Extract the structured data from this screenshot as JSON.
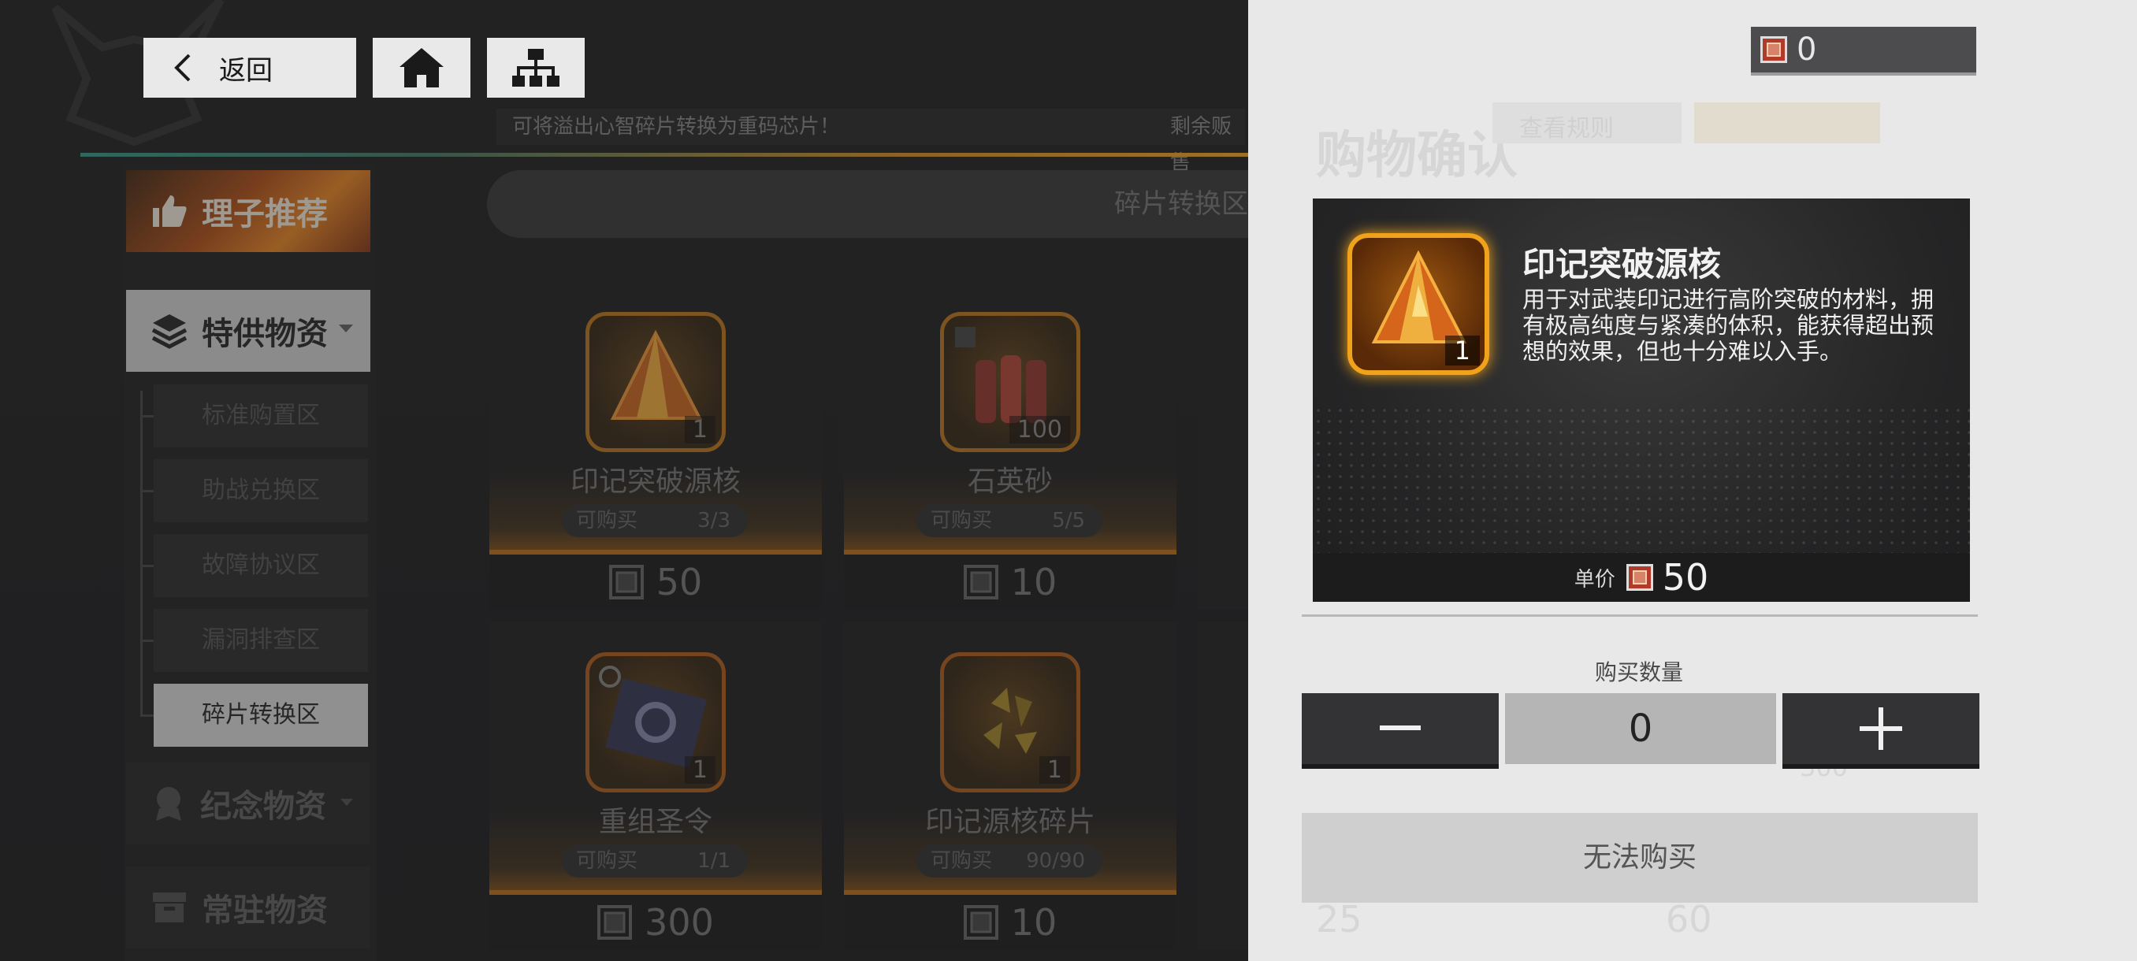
{
  "topbar": {
    "back_label": "返回",
    "notice": "可将溢出心智碎片转换为重码芯片！",
    "notice_right": "剩余贩售"
  },
  "sidebar": {
    "recommend": "理子推荐",
    "special": "特供物资",
    "sub_items": [
      "标准购置区",
      "助战兑换区",
      "故障协议区",
      "漏洞排查区",
      "碎片转换区"
    ],
    "memorial": "纪念物资",
    "permanent": "常驻物资"
  },
  "zone_title": "碎片转换区",
  "cards": [
    {
      "name": "印记突破源核",
      "count": "1",
      "stock_label": "可购买",
      "stock": "3/3",
      "price": "50"
    },
    {
      "name": "石英砂",
      "count": "100",
      "stock_label": "可购买",
      "stock": "5/5",
      "price": "10"
    },
    {
      "name": "重组圣令",
      "count": "1",
      "stock_label": "可购买",
      "stock": "1/1",
      "price": "300"
    },
    {
      "name": "印记源核碎片",
      "count": "1",
      "stock_label": "可购买",
      "stock": "90/90",
      "price": "10"
    }
  ],
  "panel": {
    "currency_value": "0",
    "title_ghost": "购物确认",
    "ghost_rules": "查看规则",
    "item": {
      "name": "印记突破源核",
      "count": "1",
      "description": "用于对武装印记进行高阶突破的材料，拥有极高纯度与紧凑的体积，能获得超出预想的效果，但也十分难以入手。",
      "unit_price_label": "单价",
      "unit_price": "50"
    },
    "quantity_label": "购买数量",
    "quantity": "0",
    "buy_label": "无法购买",
    "ghost_prices": [
      "25",
      "60"
    ],
    "ghost_count": "300"
  },
  "colors": {
    "accent_orange": "#f0a21a",
    "panel_bg": "#e8e8e8",
    "dark": "#333335"
  }
}
